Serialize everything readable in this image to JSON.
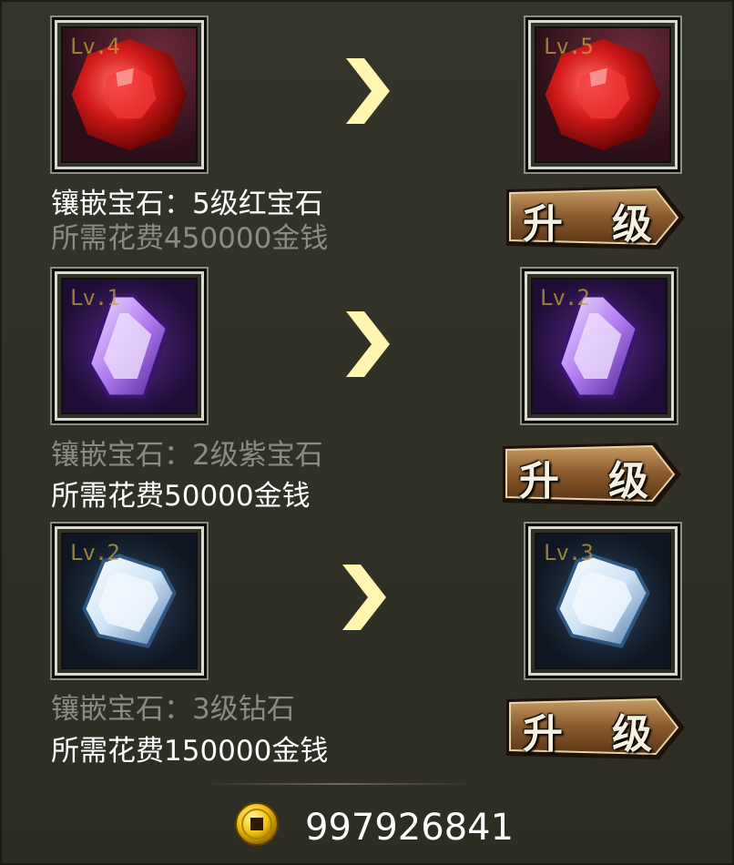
{
  "colors": {
    "background": "#2f2f24",
    "label_bright": "#ffffff",
    "label_dim": "#8b8b85",
    "arrow": "#fff7b0"
  },
  "rows": [
    {
      "gem": "ruby",
      "current_level": "Lv.4",
      "next_level": "Lv.5",
      "inlay_text": "镶嵌宝石：5级红宝石",
      "cost_text": "所需花费450000金钱",
      "inlay_style": "bright",
      "cost_style": "dim",
      "button_left": "升",
      "button_right": "级"
    },
    {
      "gem": "amethyst",
      "current_level": "Lv.1",
      "next_level": "Lv.2",
      "inlay_text": "镶嵌宝石：2级紫宝石",
      "cost_text": "所需花费50000金钱",
      "inlay_style": "dim",
      "cost_style": "bright",
      "button_left": "升",
      "button_right": "级"
    },
    {
      "gem": "diamond",
      "current_level": "Lv.2",
      "next_level": "Lv.3",
      "inlay_text": "镶嵌宝石：3级钻石",
      "cost_text": "所需花费150000金钱",
      "inlay_style": "dim",
      "cost_style": "bright",
      "button_left": "升",
      "button_right": "级"
    }
  ],
  "footer": {
    "coin_icon": "gold-coin-icon",
    "gold_amount": "997926841"
  }
}
